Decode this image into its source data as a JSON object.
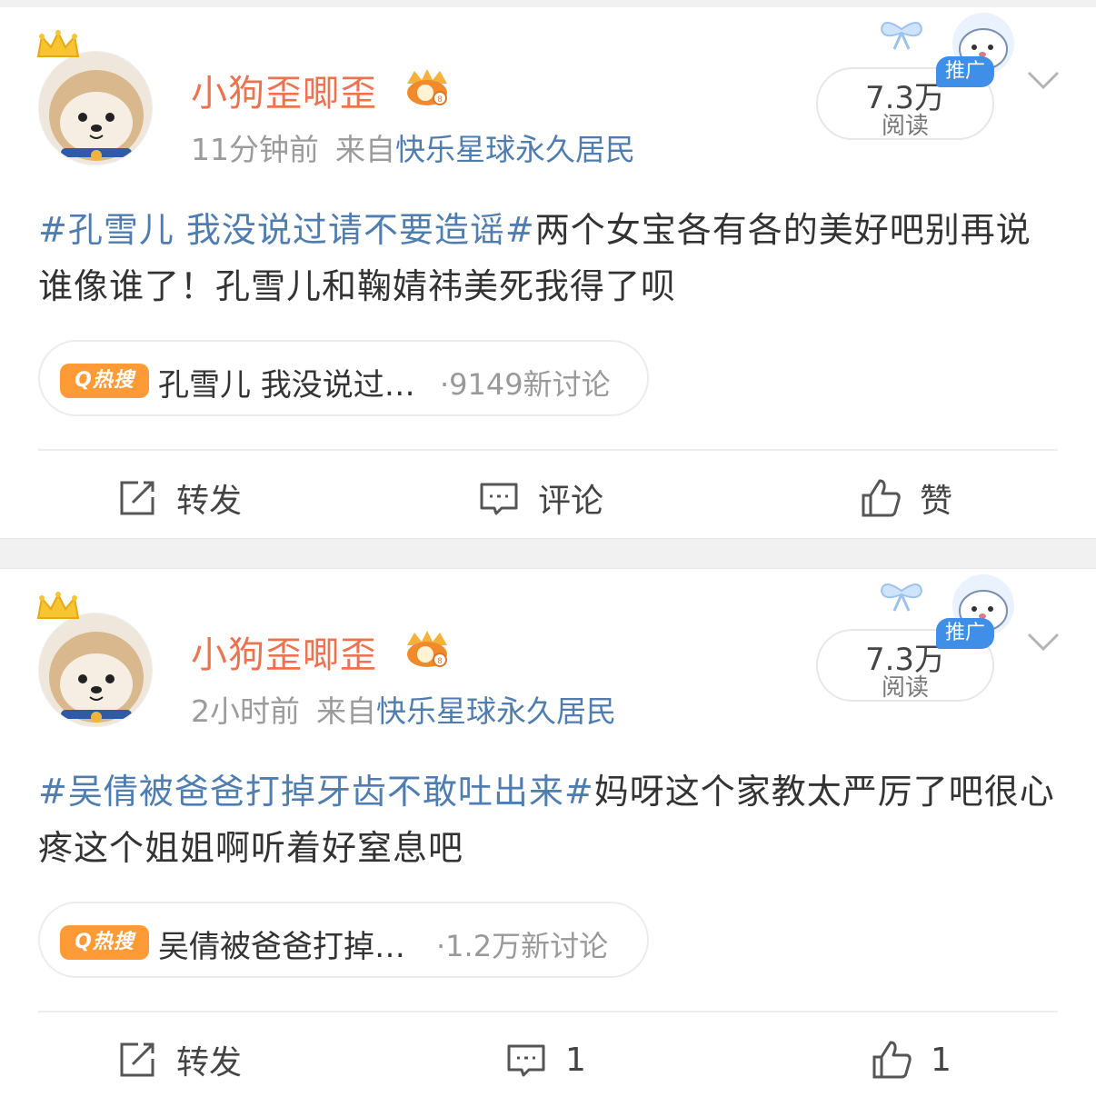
{
  "posts": [
    {
      "username": "小狗歪唧歪",
      "time": "11分钟前",
      "from_label": "来自",
      "source": "快乐星球永久居民",
      "read_count": "7.3万",
      "read_label": "阅读",
      "ad_badge": "推广",
      "text_tag": "#孔雪儿 我没说过请不要造谣#",
      "text_body": "两个女宝各有各的美好吧别再说谁像谁了！孔雪儿和鞠婧祎美死我得了呗",
      "hot_badge": "Q热搜",
      "hot_title": "孔雪儿 我没说过…",
      "hot_count": "·9149新讨论",
      "repost_label": "转发",
      "comment_label": "评论",
      "like_label": "赞"
    },
    {
      "username": "小狗歪唧歪",
      "time": "2小时前",
      "from_label": "来自",
      "source": "快乐星球永久居民",
      "read_count": "7.3万",
      "read_label": "阅读",
      "ad_badge": "推广",
      "text_tag": "#吴倩被爸爸打掉牙齿不敢吐出来#",
      "text_body": "妈呀这个家教太严厉了吧很心疼这个姐姐啊听着好窒息吧",
      "hot_badge": "Q热搜",
      "hot_title": "吴倩被爸爸打掉…",
      "hot_count": "·1.2万新讨论",
      "repost_label": "转发",
      "comment_label": "1",
      "like_label": "1"
    }
  ],
  "colors": {
    "username": "#eb7350",
    "link": "#507daf",
    "hot_badge": "#ff9b37",
    "ad_badge": "#3f8ee8"
  },
  "icons": [
    "crown-icon",
    "vip-badge-icon",
    "chevron-down-icon",
    "repost-icon",
    "comment-icon",
    "like-icon",
    "bow-decoration-icon"
  ]
}
